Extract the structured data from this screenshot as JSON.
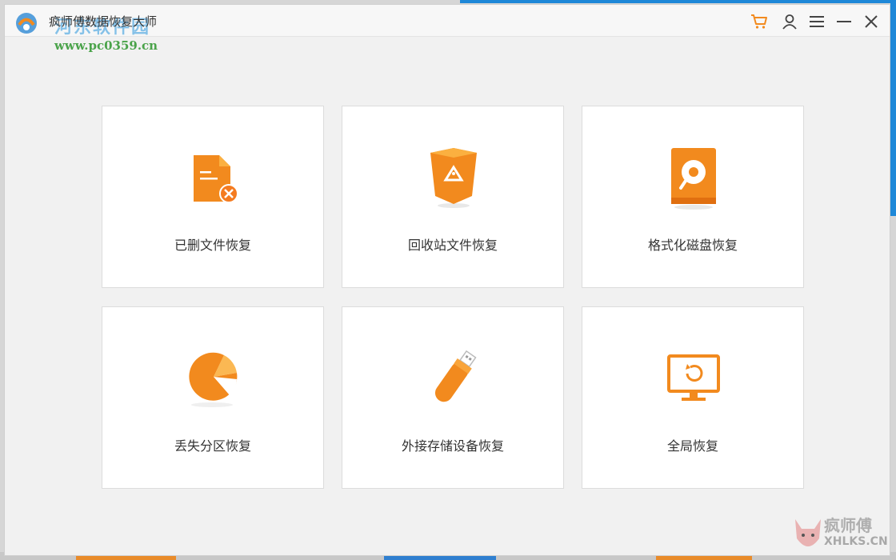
{
  "window": {
    "title": "疯师傅数据恢复大师",
    "watermark_site": "www.pc0359.cn",
    "watermark_brand": "河东软件园"
  },
  "titlebar_icons": [
    "cart-icon",
    "user-icon",
    "menu-icon",
    "minimize-icon",
    "close-icon"
  ],
  "colors": {
    "accent": "#f28a1e",
    "accent_light": "#fbb040",
    "card_bg": "#ffffff",
    "window_bg": "#f1f1f1"
  },
  "cards": [
    {
      "label": "已删文件恢复",
      "icon": "deleted-file-icon"
    },
    {
      "label": "回收站文件恢复",
      "icon": "recycle-bin-icon"
    },
    {
      "label": "格式化磁盘恢复",
      "icon": "formatted-disk-icon"
    },
    {
      "label": "丢失分区恢复",
      "icon": "lost-partition-icon"
    },
    {
      "label": "外接存储设备恢复",
      "icon": "usb-drive-icon"
    },
    {
      "label": "全局恢复",
      "icon": "full-recovery-icon"
    }
  ],
  "corner_watermark": {
    "line1": "疯师傅",
    "line2": "XHLKS.CN"
  }
}
